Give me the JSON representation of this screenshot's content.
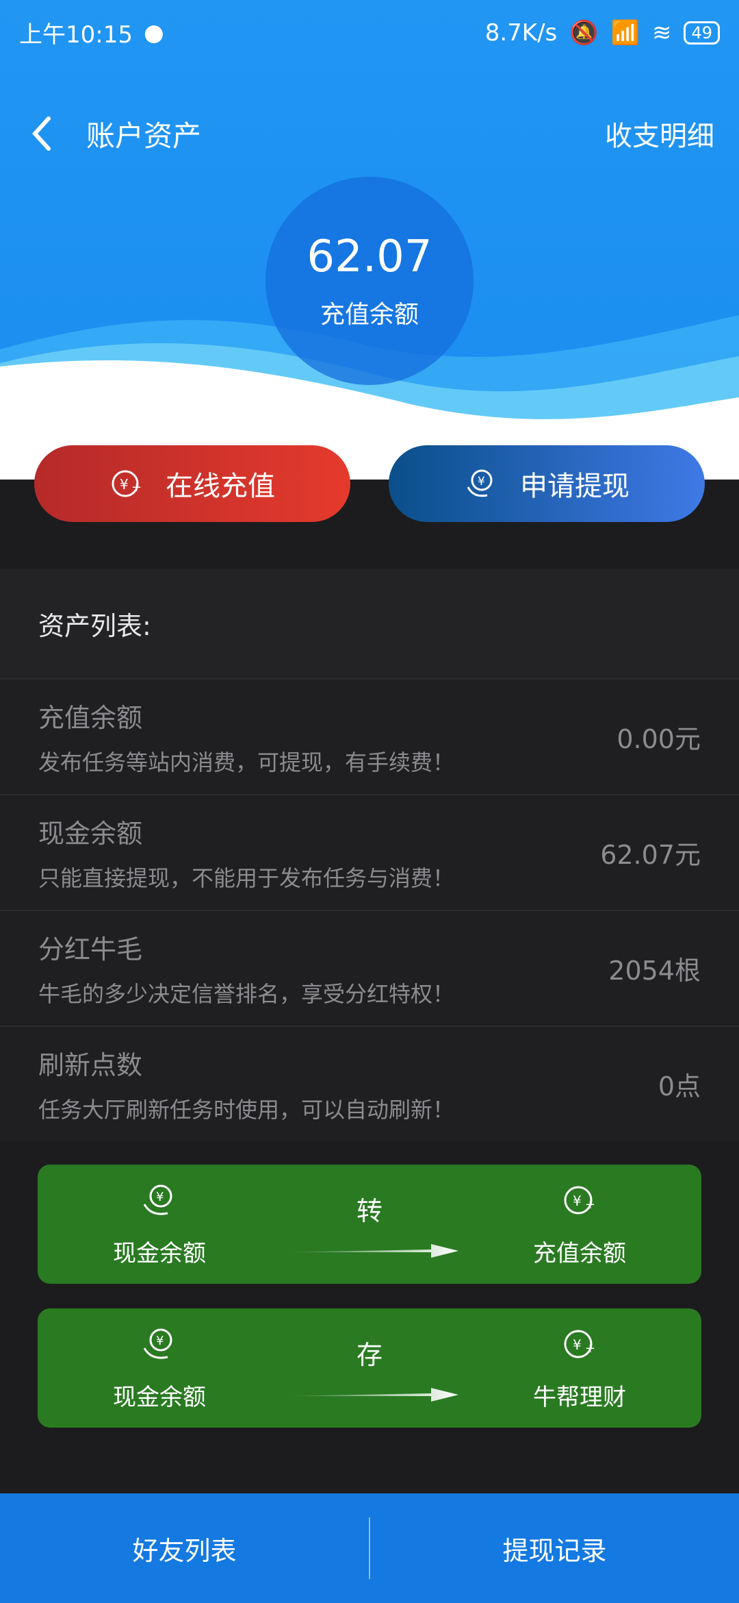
{
  "status": {
    "time": "上午10:15",
    "speed": "8.7K/s",
    "battery": "49"
  },
  "header": {
    "title": "账户资产",
    "ledger_link": "收支明细"
  },
  "balance": {
    "amount": "62.07",
    "label": "充值余额"
  },
  "actions": {
    "recharge": "在线充值",
    "withdraw": "申请提现"
  },
  "assets": {
    "heading": "资产列表:",
    "items": [
      {
        "name": "充值余额",
        "desc": "发布任务等站内消费，可提现，有手续费！",
        "value": "0.00元"
      },
      {
        "name": "现金余额",
        "desc": "只能直接提现，不能用于发布任务与消费！",
        "value": "62.07元"
      },
      {
        "name": "分红牛毛",
        "desc": "牛毛的多少决定信誉排名，享受分红特权！",
        "value": "2054根"
      },
      {
        "name": "刷新点数",
        "desc": "任务大厅刷新任务时使用，可以自动刷新！",
        "value": "0点"
      }
    ]
  },
  "transfers": [
    {
      "from": "现金余额",
      "action": "转",
      "to": "充值余额"
    },
    {
      "from": "现金余额",
      "action": "存",
      "to": "牛帮理财"
    }
  ],
  "bottom": {
    "friends": "好友列表",
    "withdraw_records": "提现记录"
  },
  "colors": {
    "brand_blue": "#1a8cf0",
    "red": "#e53a2c",
    "green": "#2a7a22"
  }
}
